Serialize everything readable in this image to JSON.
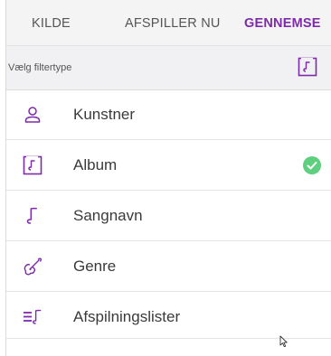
{
  "tabs": [
    {
      "label": "KILDE",
      "active": false
    },
    {
      "label": "AFSPILLER NU",
      "active": false
    },
    {
      "label": "GENNEMSE",
      "active": true
    }
  ],
  "filter_header": {
    "title": "Vælg filtertype",
    "icon": "album-note-icon"
  },
  "filters": [
    {
      "label": "Kunstner",
      "icon": "person-icon",
      "selected": false
    },
    {
      "label": "Album",
      "icon": "album-note-icon",
      "selected": true
    },
    {
      "label": "Sangnavn",
      "icon": "music-note-icon",
      "selected": false
    },
    {
      "label": "Genre",
      "icon": "guitar-icon",
      "selected": false
    },
    {
      "label": "Afspilningslister",
      "icon": "playlist-icon",
      "selected": false
    }
  ],
  "colors": {
    "accent": "#7d2ba9",
    "tab_inactive": "#555555",
    "check": "#5ecf7f",
    "header_bg": "#f1f1f3"
  }
}
